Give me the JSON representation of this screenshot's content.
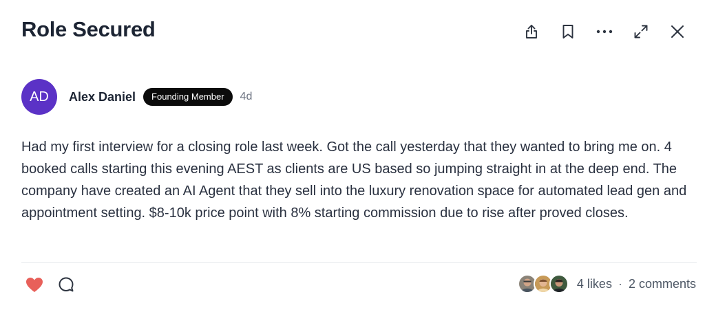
{
  "post": {
    "title": "Role Secured",
    "author": {
      "initials": "AD",
      "name": "Alex Daniel",
      "badge": "Founding Member",
      "time": "4d",
      "avatar_color": "#5b32c6"
    },
    "body": "Had my first interview for a closing role last week. Got the call yesterday that they wanted to bring me on. 4 booked calls starting this evening AEST as clients are US based so jumping straight in at the deep end. The company have created an AI Agent that they sell into the luxury renovation space for automated lead gen and appointment setting. $8-10k price point with 8% starting commission due to rise after proved closes."
  },
  "toolbar": {
    "icons": [
      "share-icon",
      "bookmark-icon",
      "more-icon",
      "expand-icon",
      "close-icon"
    ]
  },
  "footer": {
    "likes": "4 likes",
    "separator": "·",
    "comments": "2 comments",
    "like_color": "#e8605a"
  }
}
